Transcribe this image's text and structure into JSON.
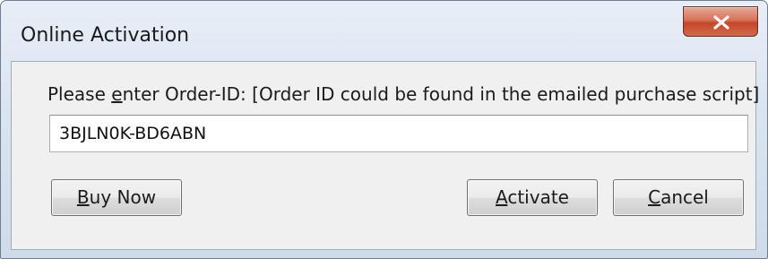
{
  "window": {
    "title": "Online Activation",
    "close_icon": "close-icon"
  },
  "form": {
    "prompt_prefix": "Please ",
    "prompt_mnemonic": "e",
    "prompt_rest": "nter Order-ID:  [Order ID could be found in the emailed purchase script]",
    "order_id_value": "3BJLN0K-BD6ABN"
  },
  "buttons": {
    "buy_now": {
      "mnemonic": "B",
      "rest": "uy Now"
    },
    "activate": {
      "mnemonic": "A",
      "rest": "ctivate"
    },
    "cancel": {
      "mnemonic": "C",
      "rest": "ancel"
    }
  },
  "colors": {
    "close_button": "#c44729",
    "client_background": "#f0f0f0",
    "frame_border": "#6f7d8f"
  }
}
